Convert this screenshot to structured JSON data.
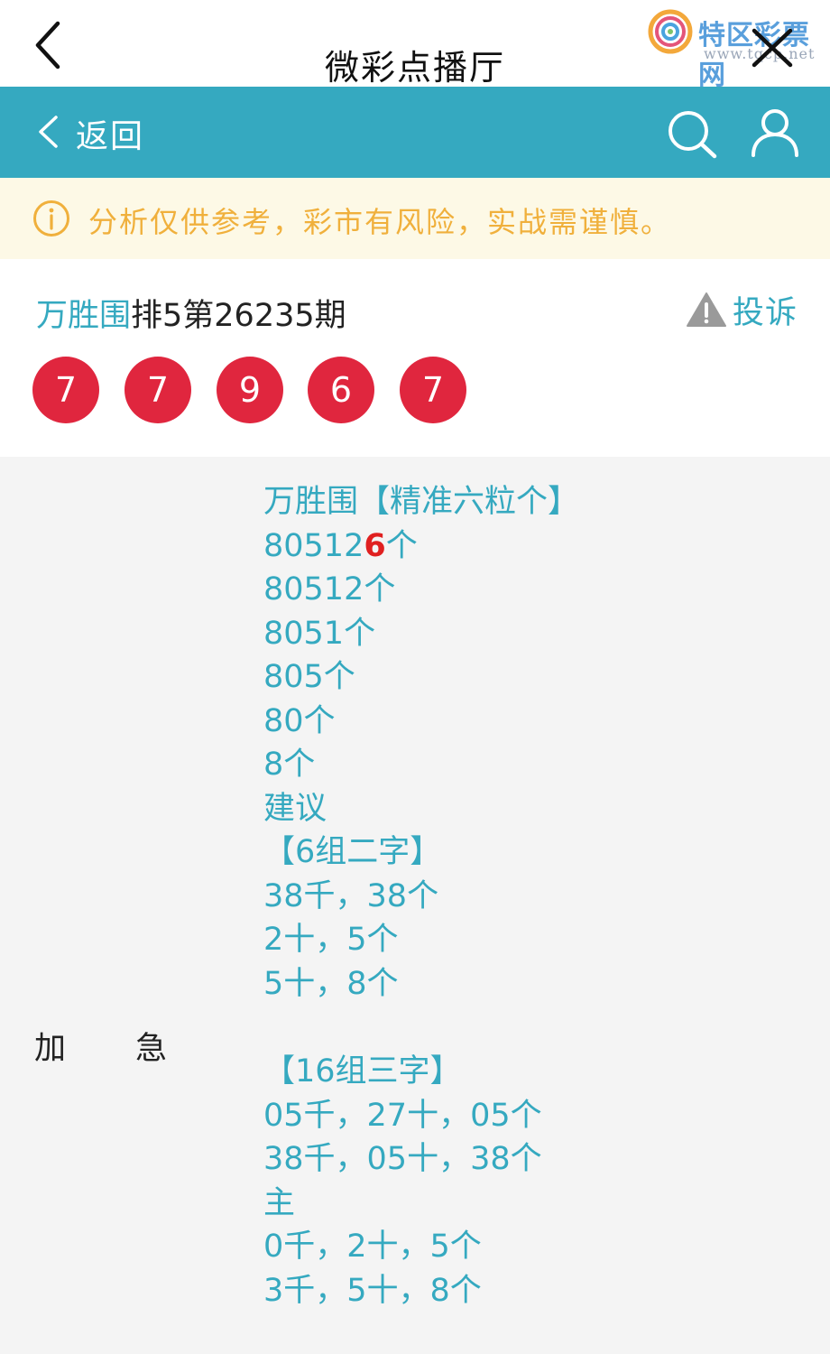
{
  "titlebar": {
    "title": "微彩点播厅",
    "logo_text": "特区彩票网",
    "logo_url": "www.tqcp.net"
  },
  "navbar": {
    "back_label": "返回"
  },
  "warning": {
    "text": "分析仅供参考，彩市有风险，实战需谨慎。"
  },
  "card": {
    "brand": "万胜围",
    "issue": "排5第26235期",
    "complaint_label": "投诉",
    "balls": [
      "7",
      "7",
      "9",
      "6",
      "7"
    ]
  },
  "content": {
    "lines": [
      "万胜围【精准六粒个】",
      "80512",
      "80512个",
      "8051个",
      "805个",
      "80个",
      "8个",
      "建议",
      "【6组二字】",
      "38千，38个",
      "2十，5个",
      "5十，8个",
      "【16组三字】",
      "05千，27十，05个",
      "38千，05十，38个",
      "主",
      "0千，2十，5个",
      "3千，5十，8个"
    ],
    "line1_highlight": "6",
    "line1_suffix": "个",
    "side_left": "加",
    "side_right": "急"
  },
  "colors": {
    "accent": "#35a9c0",
    "ball": "#e0263e",
    "warning_text": "#f0b03c",
    "highlight": "#e02020"
  }
}
